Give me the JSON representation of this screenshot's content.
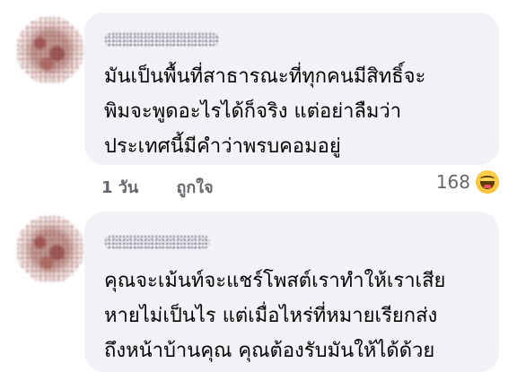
{
  "comments": [
    {
      "lines": [
        "มันเป็นพื้นที่สาธารณะที่ทุกคนมีสิทธิ์จะ",
        "พิมจะพูดอะไรได้ก็จริง แต่อย่าลืมว่า",
        "ประเทศนี้มีคำว่าพรบคอมอยู่"
      ],
      "time": "1 วัน",
      "like_label": "ถูกใจ",
      "reaction_count": "168",
      "reaction_icon": "haha-icon"
    },
    {
      "lines": [
        "คุณจะเม้นท์จะแชร์โพสต์เราทำให้เราเสีย",
        "หายไม่เป็นไร แต่เมื่อไหร่ที่หมายเรียกส่ง",
        "ถึงหน้าบ้านคุณ คุณต้องรับมันให้ได้ด้วย"
      ]
    }
  ]
}
